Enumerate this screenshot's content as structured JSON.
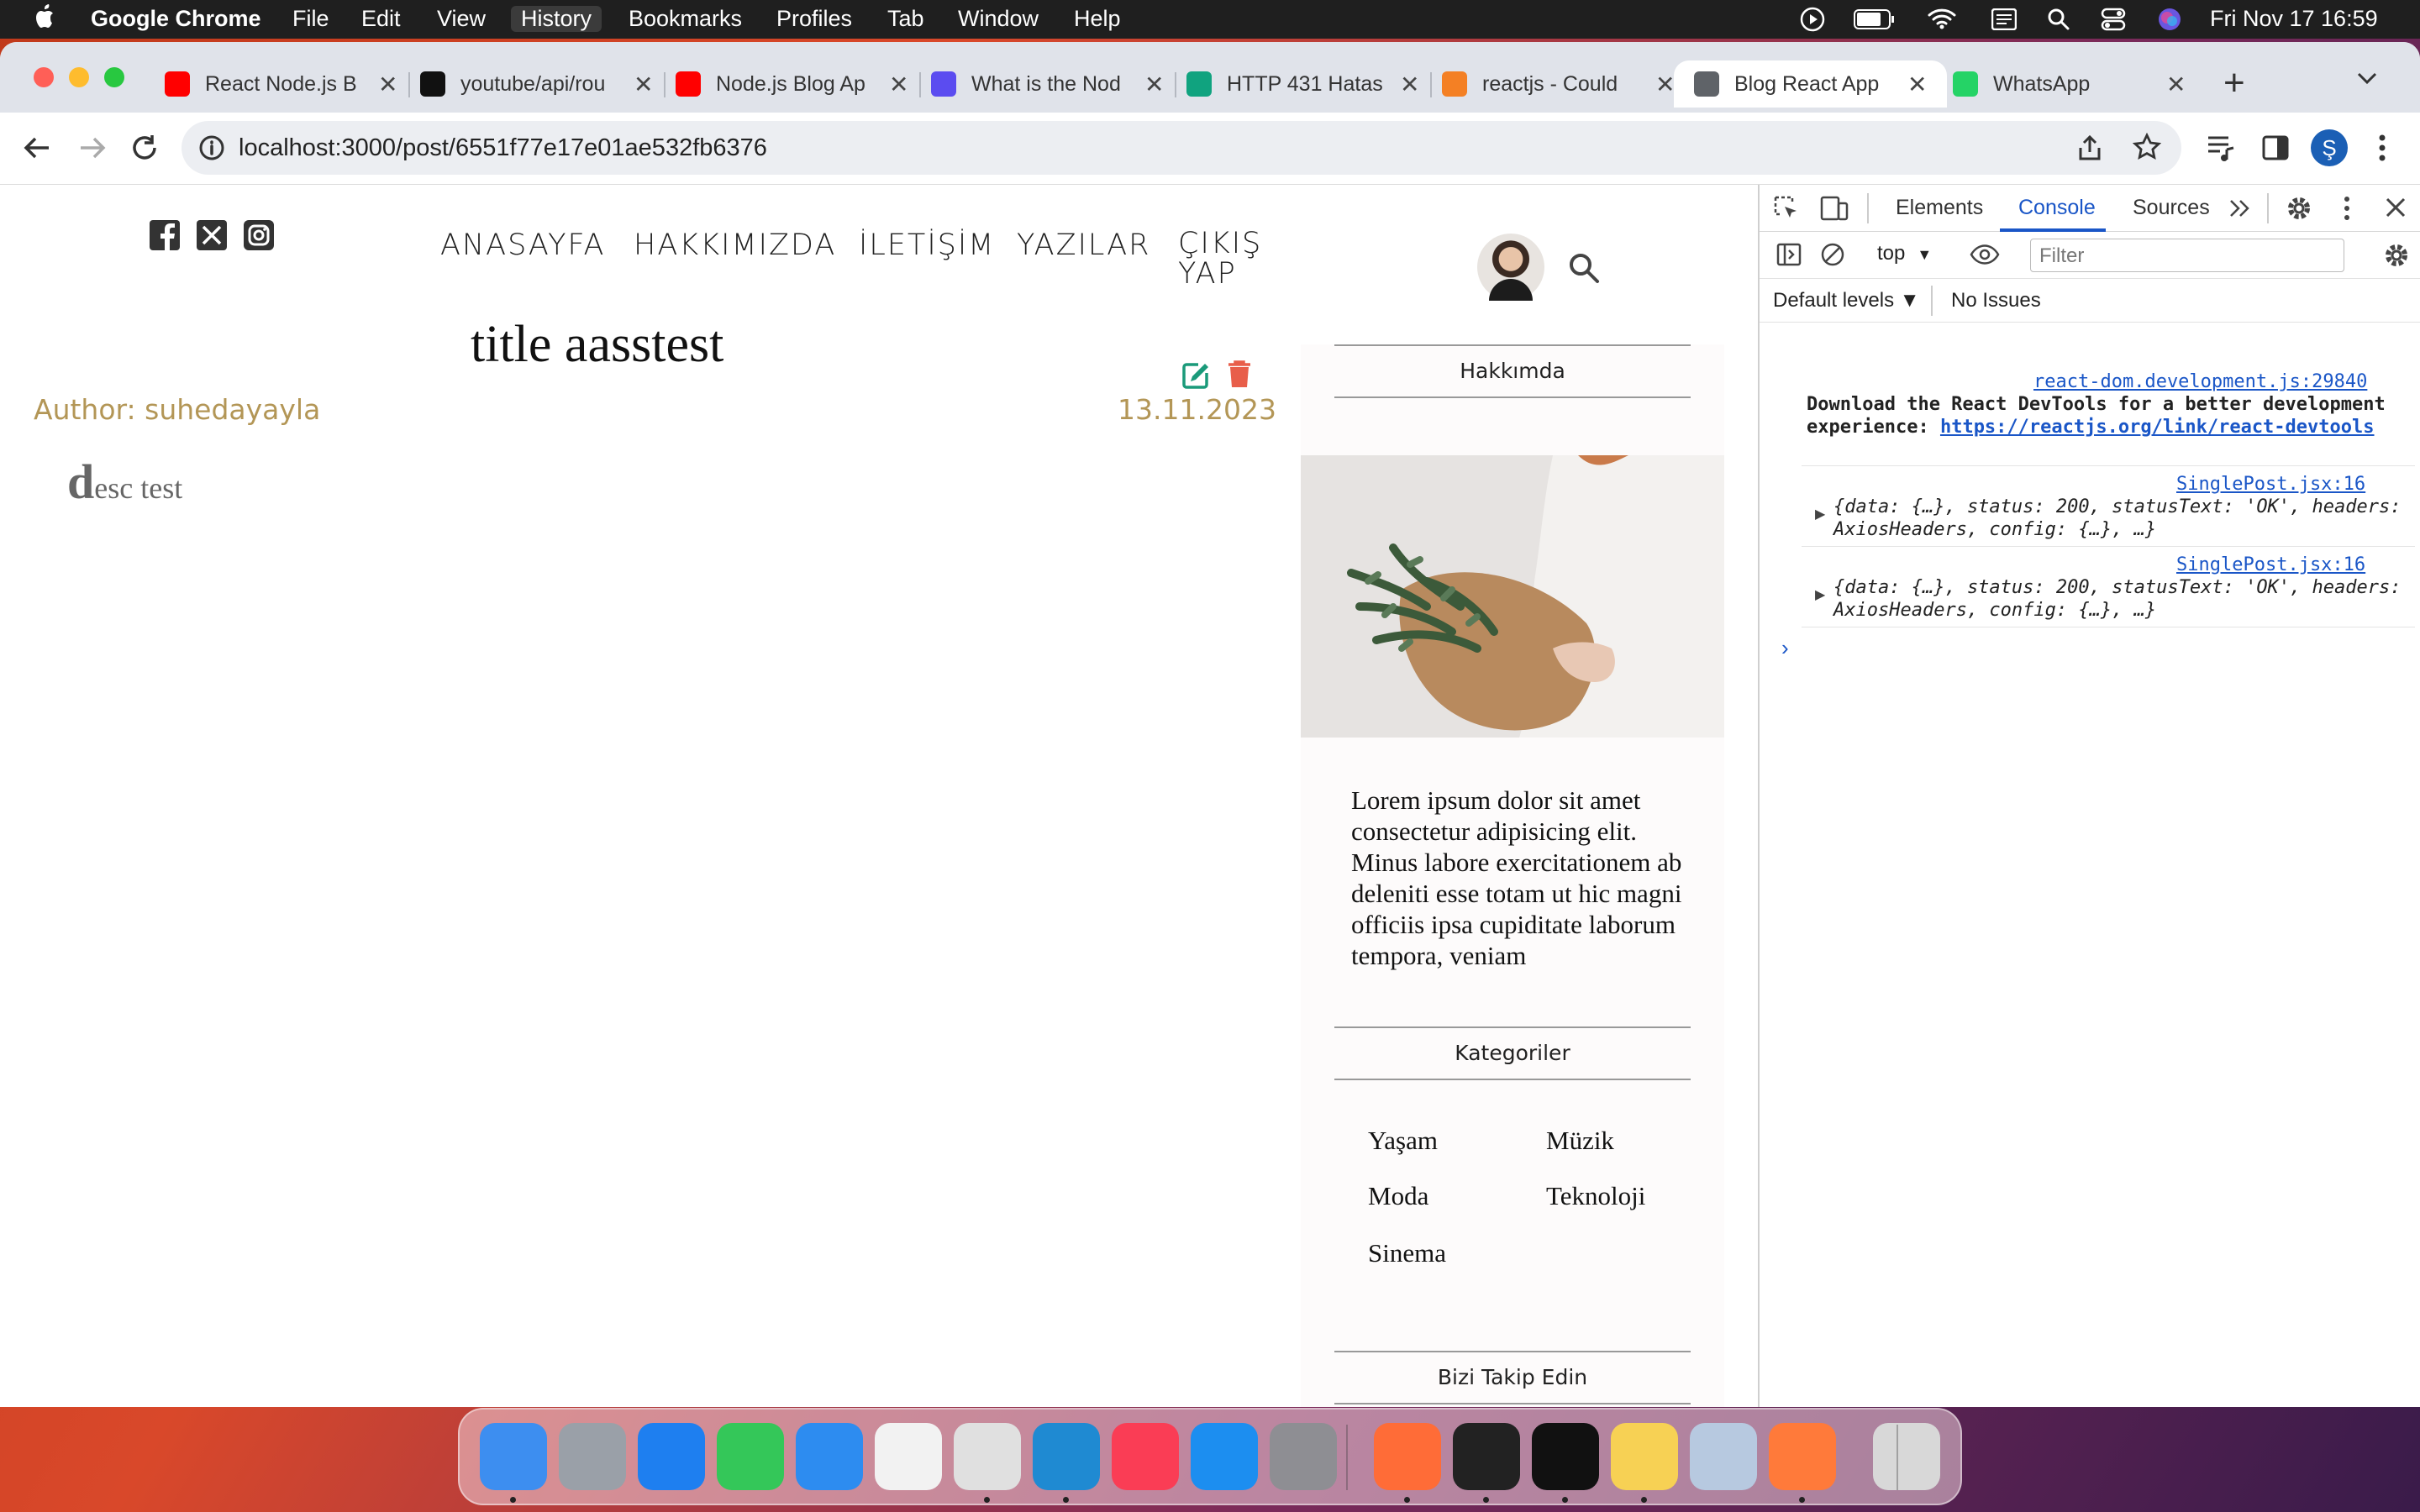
{
  "menubar": {
    "app": "Google Chrome",
    "items": [
      "File",
      "Edit",
      "View",
      "History",
      "Bookmarks",
      "Profiles",
      "Tab",
      "Window",
      "Help"
    ],
    "datetime": "Fri Nov 17  16:59"
  },
  "tabs": [
    {
      "title": "React Node.js B",
      "favicon_color": "#ff0000",
      "favicon": "youtube-icon"
    },
    {
      "title": "youtube/api/rou",
      "favicon_color": "#111111",
      "favicon": "github-icon"
    },
    {
      "title": "Node.js Blog Ap",
      "favicon_color": "#ff0000",
      "favicon": "youtube-icon"
    },
    {
      "title": "What is the Nod",
      "favicon_color": "#5b4cf0",
      "favicon": "terminal-icon"
    },
    {
      "title": "HTTP 431 Hatas",
      "favicon_color": "#10a37f",
      "favicon": "chatgpt-icon"
    },
    {
      "title": "reactjs - Could",
      "favicon_color": "#f48024",
      "favicon": "stackoverflow-icon"
    },
    {
      "title": "Blog React App",
      "favicon_color": "#5f6368",
      "favicon": "globe-icon",
      "active": true
    },
    {
      "title": "WhatsApp",
      "favicon_color": "#25d366",
      "favicon": "whatsapp-icon"
    }
  ],
  "toolbar": {
    "url": "localhost:3000/post/6551f77e17e01ae532fb6376",
    "profile_initial": "Ş"
  },
  "blog": {
    "nav": [
      "ANASAYFA",
      "HAKKIMIZDA",
      "İLETİŞİM",
      "YAZILAR",
      "ÇIKIŞ YAP"
    ],
    "post": {
      "title": "title aasstest",
      "author": "Author: suhedayayla",
      "date": "13.11.2023",
      "desc_first": "d",
      "desc_rest": "esc test"
    },
    "sidebar": {
      "about_title": "Hakkımda",
      "about_text": "Lorem ipsum dolor sit amet consectetur adipisicing elit. Minus labore exercitationem ab deleniti esse totam ut hic magni officiis ipsa cupiditate laborum tempora, veniam",
      "categories_title": "Kategoriler",
      "categories": [
        "Yaşam",
        "Müzik",
        "Moda",
        "Teknoloji",
        "Sinema"
      ],
      "follow_title": "Bizi Takip Edin"
    }
  },
  "devtools": {
    "tabs": [
      "Elements",
      "Console",
      "Sources"
    ],
    "active_tab": "Console",
    "context": "top",
    "filter_placeholder": "Filter",
    "levels": "Default levels ▼",
    "issues": "No Issues",
    "logs": [
      {
        "source": "react-dom.development.js:29840",
        "text_plain": "Download the React DevTools for a better development experience: ",
        "link": "https://reactjs.org/link/react-devtools"
      },
      {
        "source": "SinglePost.jsx:16",
        "text": "{data: {…}, status: 200, statusText: 'OK', headers: AxiosHeaders, config: {…}, …}"
      },
      {
        "source": "SinglePost.jsx:16",
        "text": "{data: {…}, status: 200, statusText: 'OK', headers: AxiosHeaders, config: {…}, …}"
      }
    ]
  },
  "dock": {
    "apps": [
      {
        "name": "finder-icon",
        "color": "#3d8ef0"
      },
      {
        "name": "launchpad-icon",
        "color": "#9aa0a8"
      },
      {
        "name": "safari-icon",
        "color": "#1e7ff0"
      },
      {
        "name": "messages-icon",
        "color": "#34c759"
      },
      {
        "name": "mail-icon",
        "color": "#2d8cf0"
      },
      {
        "name": "photos-icon",
        "color": "#f2f2f2"
      },
      {
        "name": "chrome-icon",
        "color": "#e0e0e0"
      },
      {
        "name": "vscode-icon",
        "color": "#1f8ad2"
      },
      {
        "name": "music-icon",
        "color": "#fa3d55"
      },
      {
        "name": "appstore-icon",
        "color": "#1c8ef0"
      },
      {
        "name": "settings-icon",
        "color": "#8e8e93"
      },
      {
        "name": "postman-icon",
        "color": "#ff6c37"
      },
      {
        "name": "activity-monitor-icon",
        "color": "#222222"
      },
      {
        "name": "terminal-icon",
        "color": "#111111"
      },
      {
        "name": "notes-icon",
        "color": "#f7d154"
      },
      {
        "name": "preview-icon",
        "color": "#b7c9e0"
      },
      {
        "name": "postman-app-icon",
        "color": "#ff7a3a"
      },
      {
        "name": "trash-icon",
        "color": "#d8d8d8"
      }
    ]
  }
}
